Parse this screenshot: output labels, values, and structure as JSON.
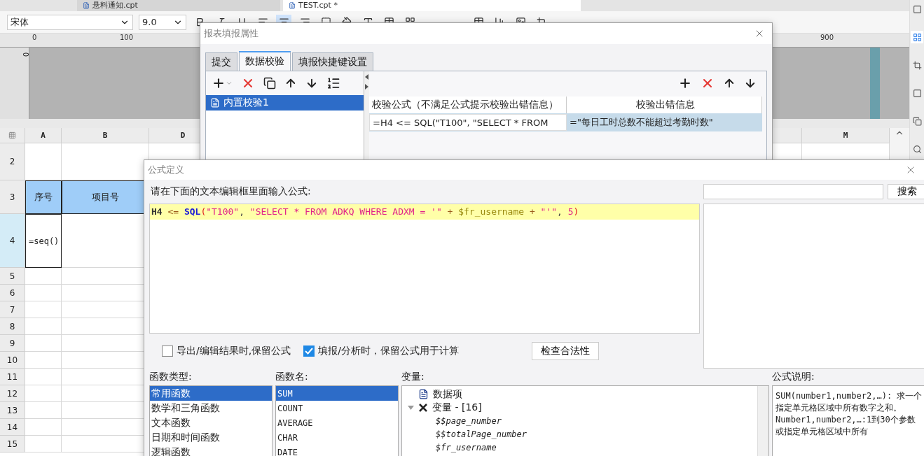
{
  "doc_tabs": [
    {
      "label": "悬料通知.cpt",
      "selected": false
    },
    {
      "label": "TEST.cpt *",
      "selected": true
    }
  ],
  "toolbar": {
    "font": "宋体",
    "size": "9.0"
  },
  "ruler": {
    "top_labels": [
      "0",
      "100",
      "900"
    ],
    "side_label": "0"
  },
  "sheet": {
    "columns": [
      "A",
      "B",
      "D",
      "M"
    ],
    "rows": [
      {
        "number": "2",
        "selected": false
      },
      {
        "number": "3",
        "selected": false,
        "cells": [
          {
            "text": "序号",
            "kind": "header"
          },
          {
            "text": "项目号",
            "kind": "header"
          }
        ]
      },
      {
        "number": "4",
        "selected": true,
        "cells": [
          {
            "text": "=seq()",
            "kind": "formula"
          }
        ]
      },
      {
        "number": "5",
        "selected": false
      },
      {
        "number": "6",
        "selected": false
      },
      {
        "number": "7",
        "selected": false
      },
      {
        "number": "8",
        "selected": false
      },
      {
        "number": "9",
        "selected": false
      },
      {
        "number": "10",
        "selected": false
      },
      {
        "number": "11",
        "selected": false
      },
      {
        "number": "12",
        "selected": false
      },
      {
        "number": "13",
        "selected": false
      },
      {
        "number": "14",
        "selected": false
      },
      {
        "number": "15",
        "selected": false
      }
    ]
  },
  "report_dialog": {
    "title": "报表填报属性",
    "tabs": [
      {
        "label": "提交",
        "selected": false
      },
      {
        "label": "数据校验",
        "selected": true
      },
      {
        "label": "填报快捷键设置",
        "selected": false
      }
    ],
    "checks": [
      {
        "label": "内置校验1",
        "selected": true
      }
    ],
    "table": {
      "columns": [
        "校验公式（不满足公式提示校验出错信息）",
        "校验出错信息"
      ],
      "rows": [
        {
          "formula": "=H4 <= SQL(\"T100\", \"SELECT * FROM",
          "message": "=\"每日工时总数不能超过考勤时数\"",
          "selected": true
        }
      ]
    }
  },
  "formula_dialog": {
    "title": "公式定义",
    "prompt": "请在下面的文本编辑框里面输入公式:",
    "formula": [
      {
        "text": "H4",
        "kind": "cell",
        "gap": false
      },
      {
        "text": "<=",
        "kind": "operator",
        "gap": true
      },
      {
        "text": "SQL",
        "kind": "function",
        "gap": true
      },
      {
        "text": "(",
        "kind": "paren",
        "gap": false
      },
      {
        "text": "\"T100\"",
        "kind": "string",
        "gap": false
      },
      {
        "text": ",",
        "kind": "plain",
        "gap": false
      },
      {
        "text": "\"SELECT * FROM ADKQ WHERE ADXM = '\"",
        "kind": "string",
        "gap": true
      },
      {
        "text": "+",
        "kind": "operator",
        "gap": true
      },
      {
        "text": "$fr_username",
        "kind": "variable",
        "gap": true
      },
      {
        "text": "+",
        "kind": "operator",
        "gap": true
      },
      {
        "text": "\"'\"",
        "kind": "string",
        "gap": true
      },
      {
        "text": ",",
        "kind": "plain",
        "gap": false
      },
      {
        "text": "5",
        "kind": "number",
        "gap": true
      },
      {
        "text": ")",
        "kind": "paren",
        "gap": false
      }
    ],
    "options": [
      {
        "label": "导出/编辑结果时,保留公式",
        "checked": false
      },
      {
        "label": "填报/分析时，保留公式用于计算",
        "checked": true
      }
    ],
    "check_button": "检查合法性",
    "search": {
      "button": "搜索"
    },
    "categories": {
      "label": "函数类型:",
      "items": [
        {
          "label": "常用函数",
          "selected": true
        },
        {
          "label": "数学和三角函数",
          "selected": false
        },
        {
          "label": "文本函数",
          "selected": false
        },
        {
          "label": "日期和时间函数",
          "selected": false
        },
        {
          "label": "逻辑函数",
          "selected": false
        }
      ]
    },
    "functions": {
      "label": "函数名:",
      "items": [
        {
          "label": "SUM",
          "selected": true
        },
        {
          "label": "COUNT",
          "selected": false
        },
        {
          "label": "AVERAGE",
          "selected": false
        },
        {
          "label": "CHAR",
          "selected": false
        },
        {
          "label": "DATE",
          "selected": false
        }
      ]
    },
    "variables": {
      "label": "变量:",
      "items": [
        {
          "label": "数据项",
          "kind": "data"
        },
        {
          "label": "变量 - [16]",
          "kind": "group",
          "expanded": true,
          "children": [
            {
              "label": "$$page_number"
            },
            {
              "label": "$$totalPage_number"
            },
            {
              "label": "$fr_username"
            }
          ]
        }
      ]
    },
    "description": {
      "label": "公式说明:",
      "paragraphs": [
        "SUM(number1,number2,…): 求一个指定单元格区域中所有数字之和。",
        "Number1,number2,…:1到30个参数或指定单元格区域中所有"
      ]
    }
  }
}
